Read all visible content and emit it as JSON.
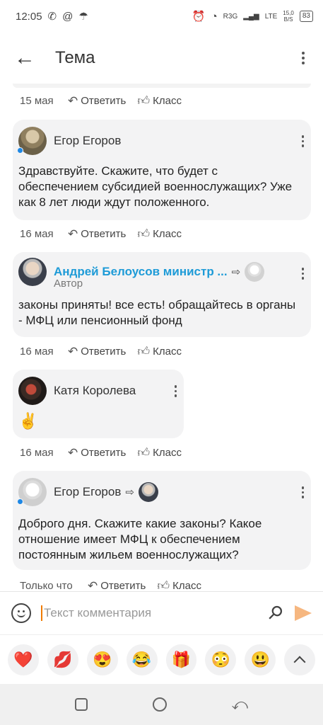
{
  "status": {
    "time": "12:05",
    "network": "R3G",
    "lte": "LTE",
    "speed_value": "15,0",
    "speed_unit": "B/S",
    "battery": "83"
  },
  "header": {
    "title": "Тема"
  },
  "actions": {
    "reply_label": "Ответить",
    "like_label": "Класс"
  },
  "feed": {
    "top_date": "15 мая",
    "comments": [
      {
        "author": "Егор Егоров",
        "text": "Здравствуйте. Скажите, что будет с обеспечением субсидией военнослужащих? Уже как 8 лет люди ждут положенного.",
        "date": "16 мая",
        "online": true
      },
      {
        "author": "Андрей Белоусов министр ...",
        "subtitle": "Автор",
        "text": "законы приняты! все есть! обращайтесь в органы - МФЦ или пенсионный фонд",
        "date": "16 мая"
      },
      {
        "author": "Катя Королева",
        "text": "✌️",
        "date": "16 мая"
      },
      {
        "author": "Егор Егоров",
        "text": "Доброго дня. Скажите какие законы? Какое отношение имеет МФЦ к обеспечением постоянным жильем военнослужащих?",
        "date": "Только что",
        "online": true
      }
    ]
  },
  "composer": {
    "placeholder": "Текст комментария"
  },
  "emojis": [
    "❤️",
    "💋",
    "😍",
    "😂",
    "🎁",
    "😳",
    "😃"
  ],
  "colors": {
    "link": "#1e9bd7",
    "online": "#1e88e5",
    "send": "#f6b780",
    "cursor": "#f07b00"
  }
}
